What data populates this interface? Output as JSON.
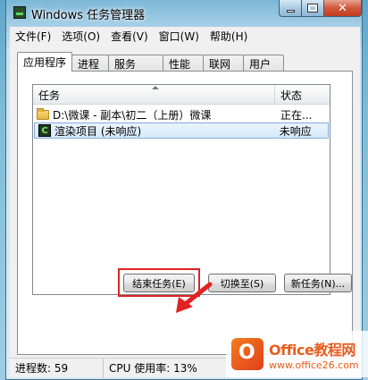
{
  "window": {
    "title": "Windows 任务管理器"
  },
  "menu": [
    "文件(F)",
    "选项(O)",
    "查看(V)",
    "窗口(W)",
    "帮助(H)"
  ],
  "tabs": [
    "应用程序",
    "进程",
    "服务",
    "性能",
    "联网",
    "用户"
  ],
  "list": {
    "columns": {
      "task": "任务",
      "status": "状态"
    },
    "rows": [
      {
        "task": "D:\\微课 - 副本\\初二（上册）微课",
        "status": "正在..."
      },
      {
        "task": "渲染项目 (未响应)",
        "status": "未响应"
      }
    ]
  },
  "buttons": {
    "end_task": "结束任务(E)",
    "switch_to": "切换至(S)",
    "new_task": "新任务(N)..."
  },
  "status_bar": {
    "processes": "进程数: 59",
    "cpu": "CPU 使用率: 13%"
  },
  "watermark": {
    "logo_letter": "O",
    "title": "Office教程网",
    "url": "www.office26.com"
  },
  "colors": {
    "highlight": "#e02222",
    "accent": "#e85d1c"
  }
}
